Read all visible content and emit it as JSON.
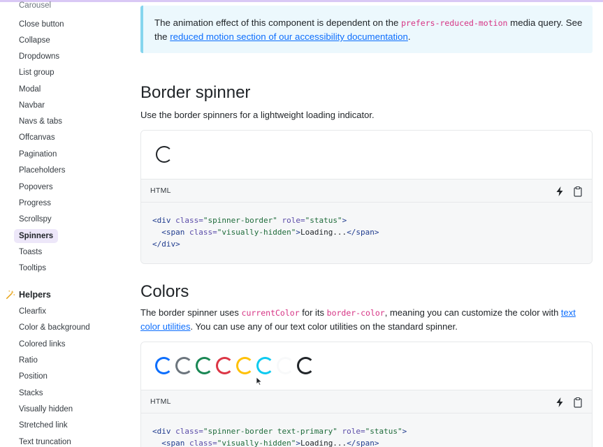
{
  "sidebar": {
    "cut_item": "Carousel",
    "items": [
      {
        "label": "Close button"
      },
      {
        "label": "Collapse"
      },
      {
        "label": "Dropdowns"
      },
      {
        "label": "List group"
      },
      {
        "label": "Modal"
      },
      {
        "label": "Navbar"
      },
      {
        "label": "Navs & tabs"
      },
      {
        "label": "Offcanvas"
      },
      {
        "label": "Pagination"
      },
      {
        "label": "Placeholders"
      },
      {
        "label": "Popovers"
      },
      {
        "label": "Progress"
      },
      {
        "label": "Scrollspy"
      },
      {
        "label": "Spinners",
        "active": true
      },
      {
        "label": "Toasts"
      },
      {
        "label": "Tooltips"
      }
    ],
    "helpers_title": "Helpers",
    "helpers_items": [
      {
        "label": "Clearfix"
      },
      {
        "label": "Color & background"
      },
      {
        "label": "Colored links"
      },
      {
        "label": "Ratio"
      },
      {
        "label": "Position"
      },
      {
        "label": "Stacks"
      },
      {
        "label": "Visually hidden"
      },
      {
        "label": "Stretched link"
      },
      {
        "label": "Text truncation"
      }
    ]
  },
  "callout": {
    "text_before": "The animation effect of this component is dependent on the ",
    "code": "prefers-reduced-motion",
    "text_middle": " media query. See the ",
    "link": "reduced motion section of our accessibility documentation",
    "text_after": "."
  },
  "border_spinner": {
    "title": "Border spinner",
    "description": "Use the border spinners for a lightweight loading indicator.",
    "code_lang": "HTML",
    "code": {
      "l1_open": "<div",
      "l1_attr1": " class=",
      "l1_val1": "\"spinner-border\"",
      "l1_attr2": " role=",
      "l1_val2": "\"status\"",
      "l1_close": ">",
      "l2_indent": "  ",
      "l2_open": "<span",
      "l2_attr": " class=",
      "l2_val": "\"visually-hidden\"",
      "l2_close": ">",
      "l2_text": "Loading...",
      "l2_end": "</span>",
      "l3": "</div>"
    }
  },
  "colors": {
    "title": "Colors",
    "text_before": "The border spinner uses ",
    "code1": "currentColor",
    "text_middle1": " for its ",
    "code2": "border-color",
    "text_middle2": ", meaning you can customize the color with ",
    "link": "text color utilities",
    "text_after": ". You can use any of our text color utilities on the standard spinner.",
    "spinner_colors": [
      "#0d6efd",
      "#6c757d",
      "#198754",
      "#dc3545",
      "#ffc107",
      "#0dcaf0",
      "#f8f9fa",
      "#212529"
    ],
    "code_lang": "HTML",
    "code": {
      "l1_open": "<div",
      "l1_attr1": " class=",
      "l1_val1": "\"spinner-border text-primary\"",
      "l1_attr2": " role=",
      "l1_val2": "\"status\"",
      "l1_close": ">",
      "l2_indent": "  ",
      "l2_open": "<span",
      "l2_attr": " class=",
      "l2_val": "\"visually-hidden\"",
      "l2_close": ">",
      "l2_text": "Loading...",
      "l2_end": "</span>"
    }
  },
  "icons": {
    "run": "lightning-icon",
    "copy": "clipboard-icon",
    "helpers": "magic-wand-icon"
  }
}
